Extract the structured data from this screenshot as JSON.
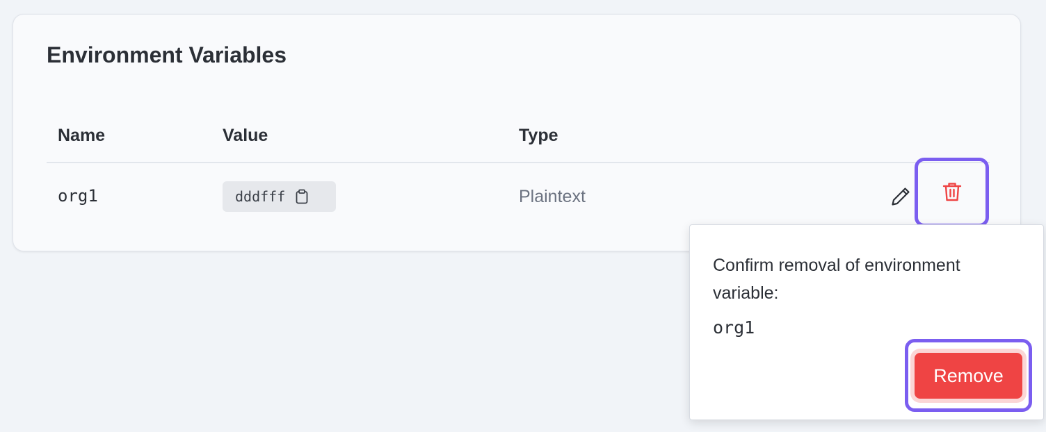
{
  "section": {
    "title": "Environment Variables"
  },
  "table": {
    "columns": [
      "Name",
      "Value",
      "Type"
    ],
    "rows": [
      {
        "name": "org1",
        "value": "dddfff",
        "type": "Plaintext"
      }
    ]
  },
  "icons": {
    "copy": "clipboard-icon",
    "edit": "pencil-icon",
    "delete": "trash-icon"
  },
  "confirm_popover": {
    "message": "Confirm removal of environment variable:",
    "variable": "org1",
    "remove_label": "Remove"
  },
  "colors": {
    "danger": "#ef4444",
    "highlight": "#7b5ef0",
    "muted_text": "#6b7280"
  }
}
